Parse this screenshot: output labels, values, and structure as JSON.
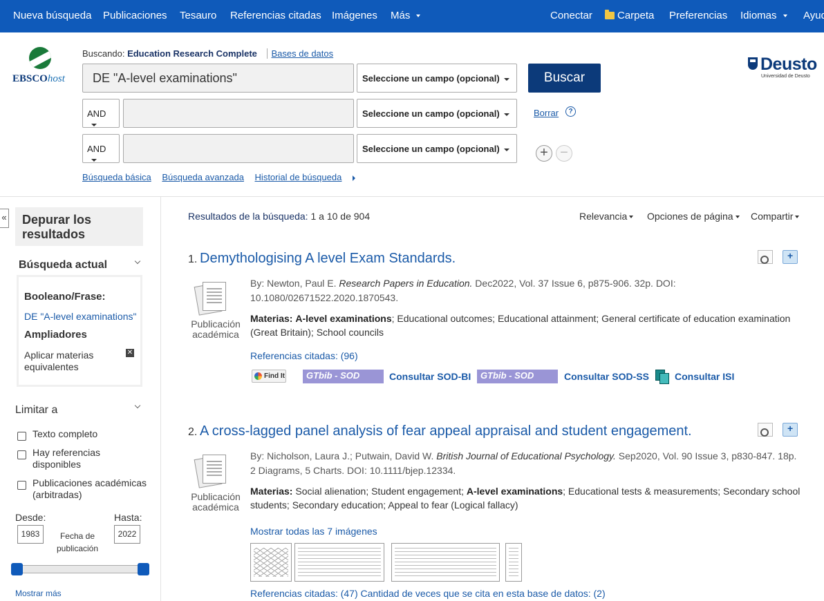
{
  "topnav": {
    "left": [
      "Nueva búsqueda",
      "Publicaciones",
      "Tesauro",
      "Referencias citadas",
      "Imágenes",
      "Más"
    ],
    "right": {
      "conectar": "Conectar",
      "carpeta": "Carpeta",
      "preferencias": "Preferencias",
      "idiomas": "Idiomas",
      "ayuda": "Ayuda"
    }
  },
  "logo": {
    "ebsco": "EBSCO",
    "host": "host"
  },
  "search": {
    "searching_label": "Buscando:",
    "database": "Education Research Complete",
    "databases_link": "Bases de datos",
    "row1_value": "DE \"A-level examinations\"",
    "field_placeholder": "Seleccione un campo (opcional)",
    "bool_op": "AND",
    "buscar": "Buscar",
    "borrar": "Borrar",
    "help": "?",
    "add": "+",
    "remove": "−",
    "links": [
      "Búsqueda básica",
      "Búsqueda avanzada",
      "Historial de búsqueda"
    ]
  },
  "deusto": {
    "name": "Deusto",
    "sub": "Universidad de Deusto"
  },
  "sidebar": {
    "collapse": "«",
    "title": "Depurar los resultados",
    "current_search": "Búsqueda actual",
    "boolean_label": "Booleano/Frase:",
    "boolean_value": "DE \"A-level examinations\"",
    "expanders_label": "Ampliadores",
    "expander_item": "Aplicar materias equivalentes",
    "limit_to": "Limitar a",
    "limits": [
      "Texto completo",
      "Hay referencias disponibles",
      "Publicaciones académicas (arbitradas)"
    ],
    "desde": "Desde:",
    "hasta": "Hasta:",
    "from_year": "1983",
    "to_year": "2022",
    "date_label": "Fecha de publicación",
    "show_more": "Mostrar más"
  },
  "results": {
    "count_label": "Resultados de la búsqueda:",
    "count_value": "1 a 10 de 904",
    "tools": [
      "Relevancia",
      "Opciones de página",
      "Compartir"
    ],
    "items": [
      {
        "num": "1.",
        "title": "Demythologising A level Exam Standards.",
        "type": "Publicación académica",
        "authors": "By: Newton, Paul E.",
        "journal": "Research Papers in Education.",
        "details": "Dec2022, Vol. 37 Issue 6, p875-906. 32p. DOI: 10.1080/02671522.2020.1870543.",
        "subjects_label": "Materias:",
        "subjects_bold": "A-level examinations",
        "subjects_rest": "; Educational outcomes; Educational attainment; General certificate of education examination (Great Britain); School councils",
        "citations": "Referencias citadas: (96)",
        "findit": "Find It",
        "gtbib": "GTbib - SOD",
        "sod_bi": "Consultar SOD-BI",
        "sod_ss": "Consultar SOD-SS",
        "isi": "Consultar ISI"
      },
      {
        "num": "2.",
        "title": "A cross-lagged panel analysis of fear appeal appraisal and student engagement.",
        "type": "Publicación académica",
        "authors": "By: Nicholson, Laura J.; Putwain, David W.",
        "journal": "British Journal of Educational Psychology.",
        "details": "Sep2020, Vol. 90 Issue 3, p830-847. 18p. 2 Diagrams, 5 Charts. DOI: 10.1111/bjep.12334.",
        "subjects_label": "Materias:",
        "subjects_pre": "Social alienation; Student engagement;",
        "subjects_bold": "A-level examinations",
        "subjects_rest": "; Educational tests & measurements; Secondary school students; Secondary education; Appeal to fear (Logical fallacy)",
        "images_link": "Mostrar todas las 7 imágenes",
        "citations": "Referencias citadas: (47) Cantidad de veces que se cita en esta base de datos: (2)"
      }
    ]
  }
}
